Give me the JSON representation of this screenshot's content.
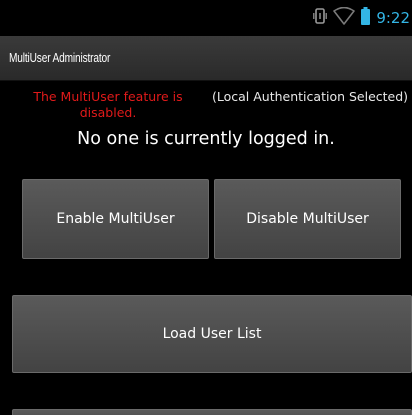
{
  "status_bar": {
    "time": "9:22",
    "icons": [
      "vibrate-icon",
      "wifi-icon",
      "battery-icon"
    ],
    "accent_color": "#33b5e5"
  },
  "app_bar": {
    "title": "MultiUser Administrator"
  },
  "messages": {
    "feature_status": "The MultiUser feature is disabled.",
    "feature_status_color": "#e01a1a",
    "auth_mode": "(Local Authentication Selected)",
    "login_status": "No one is currently logged in."
  },
  "buttons": {
    "enable": "Enable MultiUser",
    "disable": "Disable MultiUser",
    "load_user_list": "Load User List"
  }
}
